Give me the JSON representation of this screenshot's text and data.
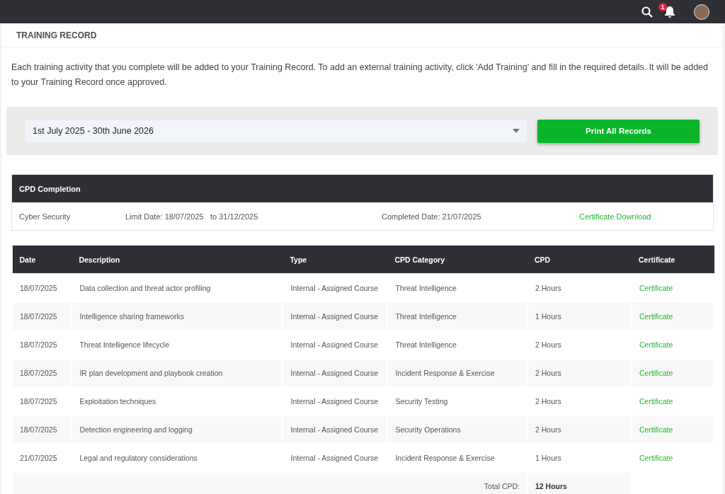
{
  "topbar": {
    "notification_count": "1"
  },
  "page_title": "TRAINING RECORD",
  "intro": "Each training activity that you complete will be added to your Training Record. To add an external training activity, click 'Add Training' and fill in the required details. It will be added to your Training Record once approved.",
  "filter": {
    "period": "1st July 2025 - 30th June 2026",
    "print_button": "Print All Records"
  },
  "cpd_completion": {
    "title": "CPD Completion",
    "rows": [
      {
        "name": "Cyber Security",
        "limit_date": "Limit Date: 18/07/2025",
        "to_date": "to 31/12/2025",
        "completed_date": "Completed Date: 21/07/2025",
        "link": "Certificate Download"
      }
    ]
  },
  "table": {
    "columns": [
      "Date",
      "Description",
      "Type",
      "CPD Category",
      "CPD",
      "Certificate"
    ],
    "rows": [
      {
        "date": "18/07/2025",
        "description": "Data collection and threat actor profiling",
        "type": "Internal - Assigned Course",
        "category": "Threat Intelligence",
        "cpd": "2 Hours",
        "certificate": "Certificate"
      },
      {
        "date": "18/07/2025",
        "description": "Intelligence sharing frameworks",
        "type": "Internal - Assigned Course",
        "category": "Threat Intelligence",
        "cpd": "1 Hours",
        "certificate": "Certificate"
      },
      {
        "date": "18/07/2025",
        "description": "Threat Intelligence lifecycle",
        "type": "Internal - Assigned Course",
        "category": "Threat Intelligence",
        "cpd": "2 Hours",
        "certificate": "Certificate"
      },
      {
        "date": "18/07/2025",
        "description": "IR plan development and playbook creation",
        "type": "Internal - Assigned Course",
        "category": "Incident Response & Exercise",
        "cpd": "2 Hours",
        "certificate": "Certificate"
      },
      {
        "date": "18/07/2025",
        "description": "Exploitation techniques",
        "type": "Internal - Assigned Course",
        "category": "Security Testing",
        "cpd": "2 Hours",
        "certificate": "Certificate"
      },
      {
        "date": "18/07/2025",
        "description": "Detection engineering and logging",
        "type": "Internal - Assigned Course",
        "category": "Security Operations",
        "cpd": "2 Hours",
        "certificate": "Certificate"
      },
      {
        "date": "21/07/2025",
        "description": "Legal and regulatory considerations",
        "type": "Internal - Assigned Course",
        "category": "Incident Response & Exercise",
        "cpd": "1 Hours",
        "certificate": "Certificate"
      }
    ],
    "total_label": "Total CPD:",
    "total_value": "12 Hours"
  }
}
